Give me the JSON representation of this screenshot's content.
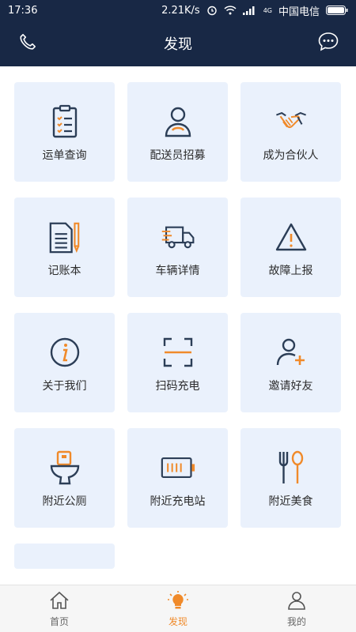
{
  "status_bar": {
    "time": "17:36",
    "speed": "2.21K/s",
    "carrier": "中国电信",
    "network": "4G"
  },
  "header": {
    "title": "发现",
    "left_icon": "phone-icon",
    "right_icon": "chat-icon"
  },
  "colors": {
    "header_bg": "#182845",
    "card_bg": "#eaf1fc",
    "icon_dark": "#2c3e57",
    "accent": "#f08a2a"
  },
  "grid": {
    "items": [
      {
        "label": "运单查询",
        "icon": "clipboard-list-icon"
      },
      {
        "label": "配送员招募",
        "icon": "person-icon"
      },
      {
        "label": "成为合伙人",
        "icon": "handshake-icon"
      },
      {
        "label": "记账本",
        "icon": "notebook-pencil-icon"
      },
      {
        "label": "车辆详情",
        "icon": "truck-icon"
      },
      {
        "label": "故障上报",
        "icon": "warning-icon"
      },
      {
        "label": "关于我们",
        "icon": "info-icon"
      },
      {
        "label": "扫码充电",
        "icon": "scan-icon"
      },
      {
        "label": "邀请好友",
        "icon": "add-user-icon"
      },
      {
        "label": "附近公厕",
        "icon": "toilet-icon"
      },
      {
        "label": "附近充电站",
        "icon": "battery-icon"
      },
      {
        "label": "附近美食",
        "icon": "fork-spoon-icon"
      }
    ]
  },
  "bottom_nav": {
    "tabs": [
      {
        "label": "首页",
        "icon": "home-icon"
      },
      {
        "label": "发现",
        "icon": "lightbulb-icon",
        "active": true
      },
      {
        "label": "我的",
        "icon": "profile-icon"
      }
    ]
  }
}
